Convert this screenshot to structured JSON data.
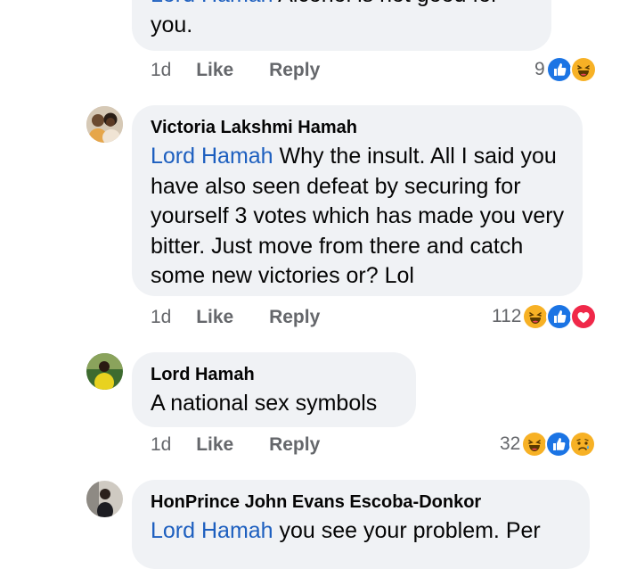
{
  "comments": [
    {
      "author": "",
      "mention": "Lord Hamah",
      "text": " Alcohol is not good for you.",
      "time": "1d",
      "like_label": "Like",
      "reply_label": "Reply",
      "reaction_count": "9",
      "reactions": [
        "like-icon",
        "haha-icon"
      ]
    },
    {
      "author": "Victoria Lakshmi Hamah",
      "mention": "Lord Hamah",
      "text": " Why the  insult. All I said you have also seen defeat by securing for yourself 3 votes which has made you very bitter. Just move from there and catch some new victories or? Lol",
      "time": "1d",
      "like_label": "Like",
      "reply_label": "Reply",
      "reaction_count": "112",
      "reactions": [
        "haha-icon",
        "like-icon",
        "love-icon"
      ]
    },
    {
      "author": "Lord Hamah",
      "mention": "",
      "text": "A national sex symbols",
      "time": "1d",
      "like_label": "Like",
      "reply_label": "Reply",
      "reaction_count": "32",
      "reactions": [
        "haha-icon",
        "like-icon",
        "sad-icon"
      ]
    },
    {
      "author": "HonPrince John Evans Escoba-Donkor",
      "mention": "Lord Hamah",
      "text": " you see your problem. Per"
    }
  ],
  "colors": {
    "mention": "#1d5fbf",
    "bubble": "#f0f2f5",
    "meta": "#65676b",
    "like": "#1b74e4",
    "love": "#f02849",
    "haha": "#f7b125"
  }
}
